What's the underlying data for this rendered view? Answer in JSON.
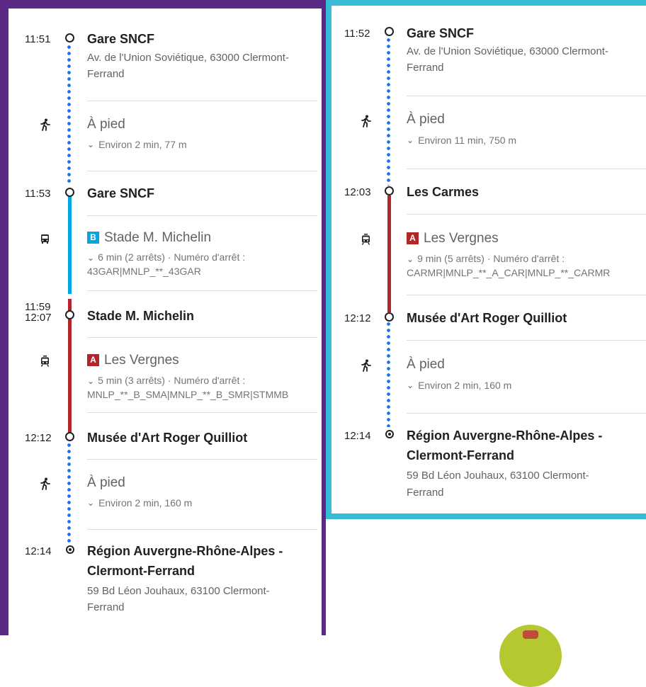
{
  "colors": {
    "left_frame": "#5b2a86",
    "right_frame": "#36bcd6",
    "walk_dots": "#1a73e8",
    "bus_line_b": "#00a6e2",
    "tram_line_a": "#b0262a"
  },
  "left": {
    "stop1": {
      "time": "11:51",
      "name": "Gare SNCF",
      "addr1": "Av. de l'Union Soviétique, 63000 Clermont-",
      "addr2": "Ferrand"
    },
    "walk1": {
      "icon": "walk-icon",
      "title": "À pied",
      "detail": "Environ 2 min, 77 m"
    },
    "stop2": {
      "time": "11:53",
      "name": "Gare SNCF"
    },
    "bus": {
      "icon": "bus-icon",
      "badge": "B",
      "name": "Stade M. Michelin",
      "detail1": "6 min (2 arrêts) · Numéro d'arrêt :",
      "detail2": "43GAR|MNLP_**_43GAR"
    },
    "stop3": {
      "time_arrive": "11:59",
      "time_depart": "12:07",
      "name": "Stade M. Michelin"
    },
    "tram": {
      "icon": "tram-icon",
      "badge": "A",
      "name": "Les Vergnes",
      "detail1": "5 min (3 arrêts) · Numéro d'arrêt :",
      "detail2": "MNLP_**_B_SMA|MNLP_**_B_SMR|STMMB"
    },
    "stop4": {
      "time": "12:12",
      "name": "Musée d'Art Roger Quilliot"
    },
    "walk2": {
      "icon": "walk-icon",
      "title": "À pied",
      "detail": "Environ 2 min, 160 m"
    },
    "dest": {
      "time": "12:14",
      "name1": "Région Auvergne-Rhône-Alpes -",
      "name2": "Clermont-Ferrand",
      "addr1": "59 Bd Léon Jouhaux, 63100 Clermont-",
      "addr2": "Ferrand"
    }
  },
  "right": {
    "stop1": {
      "time": "11:52",
      "name": "Gare SNCF",
      "addr1": "Av. de l'Union Soviétique, 63000 Clermont-",
      "addr2": "Ferrand"
    },
    "walk1": {
      "icon": "walk-icon",
      "title": "À pied",
      "detail": "Environ 11 min, 750 m"
    },
    "stop2": {
      "time": "12:03",
      "name": "Les Carmes"
    },
    "tram": {
      "icon": "tram-icon",
      "badge": "A",
      "name": "Les Vergnes",
      "detail1": "9 min (5 arrêts) · Numéro d'arrêt :",
      "detail2": "CARMR|MNLP_**_A_CAR|MNLP_**_CARMR"
    },
    "stop3": {
      "time": "12:12",
      "name": "Musée d'Art Roger Quilliot"
    },
    "walk2": {
      "icon": "walk-icon",
      "title": "À pied",
      "detail": "Environ 2 min, 160 m"
    },
    "dest": {
      "time": "12:14",
      "name1": "Région Auvergne-Rhône-Alpes -",
      "name2": "Clermont-Ferrand",
      "addr1": "59 Bd Léon Jouhaux, 63100 Clermont-",
      "addr2": "Ferrand"
    }
  }
}
